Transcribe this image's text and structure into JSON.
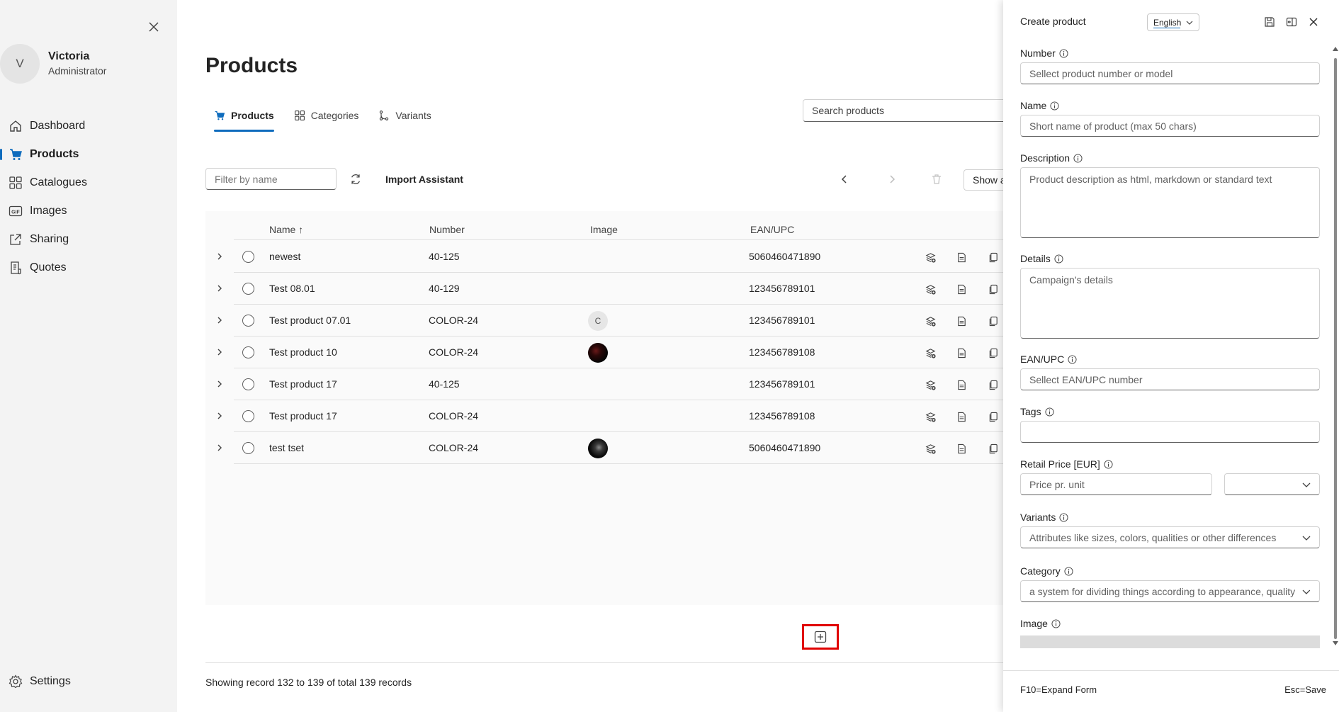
{
  "user": {
    "initial": "V",
    "name": "Victoria",
    "role": "Administrator"
  },
  "nav": {
    "items": [
      {
        "label": "Dashboard",
        "icon": "home-icon"
      },
      {
        "label": "Products",
        "icon": "cart-icon",
        "active": true
      },
      {
        "label": "Catalogues",
        "icon": "grid-icon"
      },
      {
        "label": "Images",
        "icon": "gif-icon"
      },
      {
        "label": "Sharing",
        "icon": "share-icon"
      },
      {
        "label": "Quotes",
        "icon": "receipt-icon"
      }
    ],
    "settings": "Settings"
  },
  "page": {
    "title": "Products",
    "tabs": [
      "Products",
      "Categories",
      "Variants"
    ],
    "search_placeholder": "Search products"
  },
  "toolbar": {
    "filter_placeholder": "Filter by name",
    "import_label": "Import Assistant",
    "env_label": "Show all environments"
  },
  "table": {
    "columns": [
      "Name ↑",
      "Number",
      "Image",
      "EAN/UPC"
    ],
    "rows": [
      {
        "name": "newest",
        "number": "40-125",
        "image": "",
        "ean": "5060460471890"
      },
      {
        "name": "Test 08.01",
        "number": "40-129",
        "image": "",
        "ean": "123456789101"
      },
      {
        "name": "Test product 07.01",
        "number": "COLOR-24",
        "image": "C",
        "ean": "123456789101"
      },
      {
        "name": "Test product 10",
        "number": "COLOR-24",
        "image": "photo",
        "ean": "123456789108"
      },
      {
        "name": "Test product 17",
        "number": "40-125",
        "image": "",
        "ean": "123456789101"
      },
      {
        "name": "Test product 17",
        "number": "COLOR-24",
        "image": "",
        "ean": "123456789108"
      },
      {
        "name": "test tset",
        "number": "COLOR-24",
        "image": "photo",
        "ean": "5060460471890"
      }
    ]
  },
  "footer": {
    "status": "Showing record 132 to 139 of total 139 records"
  },
  "panel": {
    "title": "Create product",
    "language": "English",
    "fields": {
      "number": {
        "label": "Number",
        "placeholder": "Sellect product number or model"
      },
      "name": {
        "label": "Name",
        "placeholder": "Short name of product (max 50 chars)"
      },
      "description": {
        "label": "Description",
        "placeholder": "Product description as html, markdown or standard text"
      },
      "details": {
        "label": "Details",
        "placeholder": "Campaign's details"
      },
      "ean": {
        "label": "EAN/UPC",
        "placeholder": "Sellect EAN/UPC number"
      },
      "tags": {
        "label": "Tags",
        "placeholder": ""
      },
      "price": {
        "label": "Retail Price [EUR]",
        "placeholder": "Price pr. unit",
        "unit_value": ""
      },
      "variants": {
        "label": "Variants",
        "placeholder": "Attributes like sizes, colors, qualities or other differences"
      },
      "category": {
        "label": "Category",
        "placeholder": "a system for dividing things according to appearance, quality"
      },
      "image": {
        "label": "Image"
      }
    },
    "footer_left": "F10=Expand Form",
    "footer_right": "Esc=Save"
  },
  "colors": {
    "accent": "#0f6cbd",
    "highlight": "#e00000",
    "sidebar_bg": "#f3f3f3",
    "grid_bg": "#fafafa"
  }
}
